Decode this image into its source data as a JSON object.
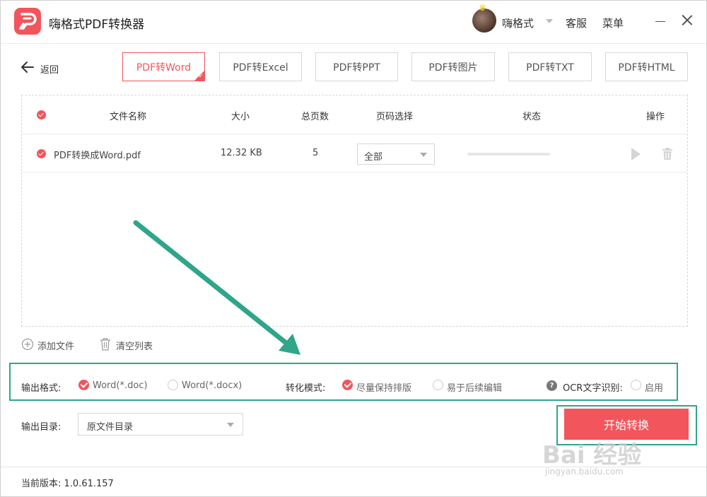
{
  "app": {
    "title": "嗨格式PDF转换器",
    "username": "嗨格式",
    "service_label": "客服",
    "menu_label": "菜单"
  },
  "nav": {
    "back_label": "返回",
    "tabs": [
      {
        "label": "PDF转Word",
        "active": true
      },
      {
        "label": "PDF转Excel",
        "active": false
      },
      {
        "label": "PDF转PPT",
        "active": false
      },
      {
        "label": "PDF转图片",
        "active": false
      },
      {
        "label": "PDF转TXT",
        "active": false
      },
      {
        "label": "PDF转HTML",
        "active": false
      }
    ]
  },
  "table": {
    "headers": {
      "name": "文件名称",
      "size": "大小",
      "pages": "总页数",
      "page_select": "页码选择",
      "status": "状态",
      "actions": "操作"
    },
    "rows": [
      {
        "checked": true,
        "name": "PDF转换成Word.pdf",
        "size": "12.32 KB",
        "pages": "5",
        "page_select": "全部",
        "progress": 0
      }
    ]
  },
  "list_actions": {
    "add_file": "添加文件",
    "clear_list": "清空列表"
  },
  "options": {
    "output_format_label": "输出格式:",
    "format_doc": "Word(*.doc)",
    "format_docx": "Word(*.docx)",
    "mode_label": "转化模式:",
    "mode_keep_layout": "尽量保持排版",
    "mode_editable": "易于后续编辑",
    "ocr_label": "OCR文字识别:",
    "ocr_enable": "启用",
    "selected_format": "Word(*.doc)",
    "selected_mode": "尽量保持排版",
    "ocr_enabled": false
  },
  "output": {
    "dir_label": "输出目录:",
    "dir_value": "原文件目录"
  },
  "start_button": "开始转换",
  "footer": {
    "version": "当前版本: 1.0.61.157"
  },
  "watermark": {
    "brand": "Bai 经验",
    "url": "jingyan.baidu.com"
  },
  "colors": {
    "accent": "#f2555b",
    "annotation": "#2fa58a"
  }
}
